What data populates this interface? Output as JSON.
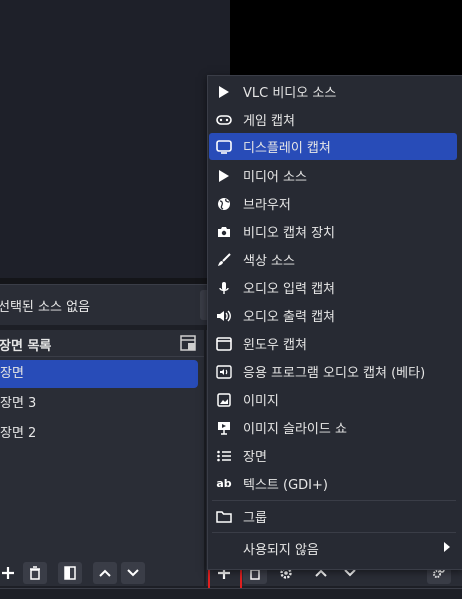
{
  "status": {
    "no_source_label": "선택된 소스 없음"
  },
  "scenes": {
    "title": "장면 목록",
    "items": [
      {
        "label": "장면",
        "active": true
      },
      {
        "label": "장면 3",
        "active": false
      },
      {
        "label": "장면 2",
        "active": false
      }
    ]
  },
  "menu": {
    "items": [
      {
        "label": "VLC 비디오 소스",
        "icon": "play-icon"
      },
      {
        "label": "게임 캡쳐",
        "icon": "gamepad-icon"
      },
      {
        "label": "디스플레이 캡쳐",
        "icon": "monitor-icon",
        "active": true
      },
      {
        "label": "미디어 소스",
        "icon": "play-icon"
      },
      {
        "label": "브라우저",
        "icon": "globe-icon"
      },
      {
        "label": "비디오 캡쳐 장치",
        "icon": "camera-icon"
      },
      {
        "label": "색상 소스",
        "icon": "brush-icon"
      },
      {
        "label": "오디오 입력 캡쳐",
        "icon": "microphone-icon"
      },
      {
        "label": "오디오 출력 캡쳐",
        "icon": "speaker-icon"
      },
      {
        "label": "윈도우 캡쳐",
        "icon": "window-icon"
      },
      {
        "label": "응용 프로그램 오디오 캡쳐 (베타)",
        "icon": "app-audio-icon"
      },
      {
        "label": "이미지",
        "icon": "image-icon"
      },
      {
        "label": "이미지 슬라이드 쇼",
        "icon": "slideshow-icon"
      },
      {
        "label": "장면",
        "icon": "list-icon"
      },
      {
        "label": "텍스트 (GDI+)",
        "icon": "text-icon"
      }
    ],
    "group_label": "그룹",
    "deprecated_label": "사용되지 않음"
  },
  "colors": {
    "accent": "#284cb8",
    "highlight": "#e02020"
  }
}
